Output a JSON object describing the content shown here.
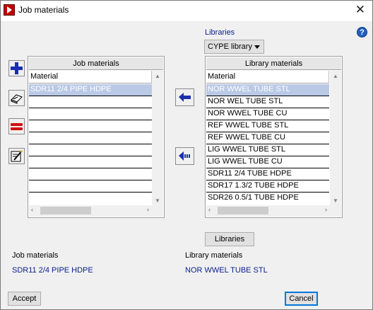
{
  "window": {
    "title": "Job materials",
    "close_label": "✕"
  },
  "help": {
    "label": "?"
  },
  "libraries": {
    "title": "Libraries",
    "selected": "CYPE library",
    "button_label": "Libraries"
  },
  "job_panel": {
    "header": "Job materials",
    "column": "Material",
    "rows": [
      "SDR11 2/4 PIPE HDPE",
      "",
      "",
      "",
      "",
      "",
      "",
      "",
      "",
      ""
    ],
    "selected_index": 0
  },
  "library_panel": {
    "header": "Library materials",
    "column": "Material",
    "rows": [
      "NOR WWEL TUBE STL",
      "NOR WEL TUBE STL",
      "NOR WWEL TUBE CU",
      "REF WWEL TUBE STL",
      "REF WWEL TUBE CU",
      "LIG WWEL TUBE STL",
      "LIG WWEL TUBE CU",
      "SDR11 2/4 TUBE HDPE",
      "SDR17 1.3/2 TUBE HDPE",
      "SDR26 0.5/1 TUBE HDPE"
    ],
    "selected_index": 0
  },
  "footer": {
    "job_label": "Job materials",
    "job_value": "SDR11 2/4 PIPE HDPE",
    "lib_label": "Library materials",
    "lib_value": "NOR WWEL TUBE STL",
    "accept": "Accept",
    "cancel": "Cancel"
  },
  "icons": {
    "add": "plus-icon",
    "copy": "eraser-icon",
    "delete": "equals-icon",
    "edit": "edit-icon",
    "transfer": "arrow-left-icon",
    "transfer_all": "arrow-left-dashed-icon"
  },
  "colors": {
    "accent_blue": "#0a1e8c",
    "selection": "#b9c9e6",
    "delete_red": "#d01010",
    "app_icon": "#c00000"
  }
}
